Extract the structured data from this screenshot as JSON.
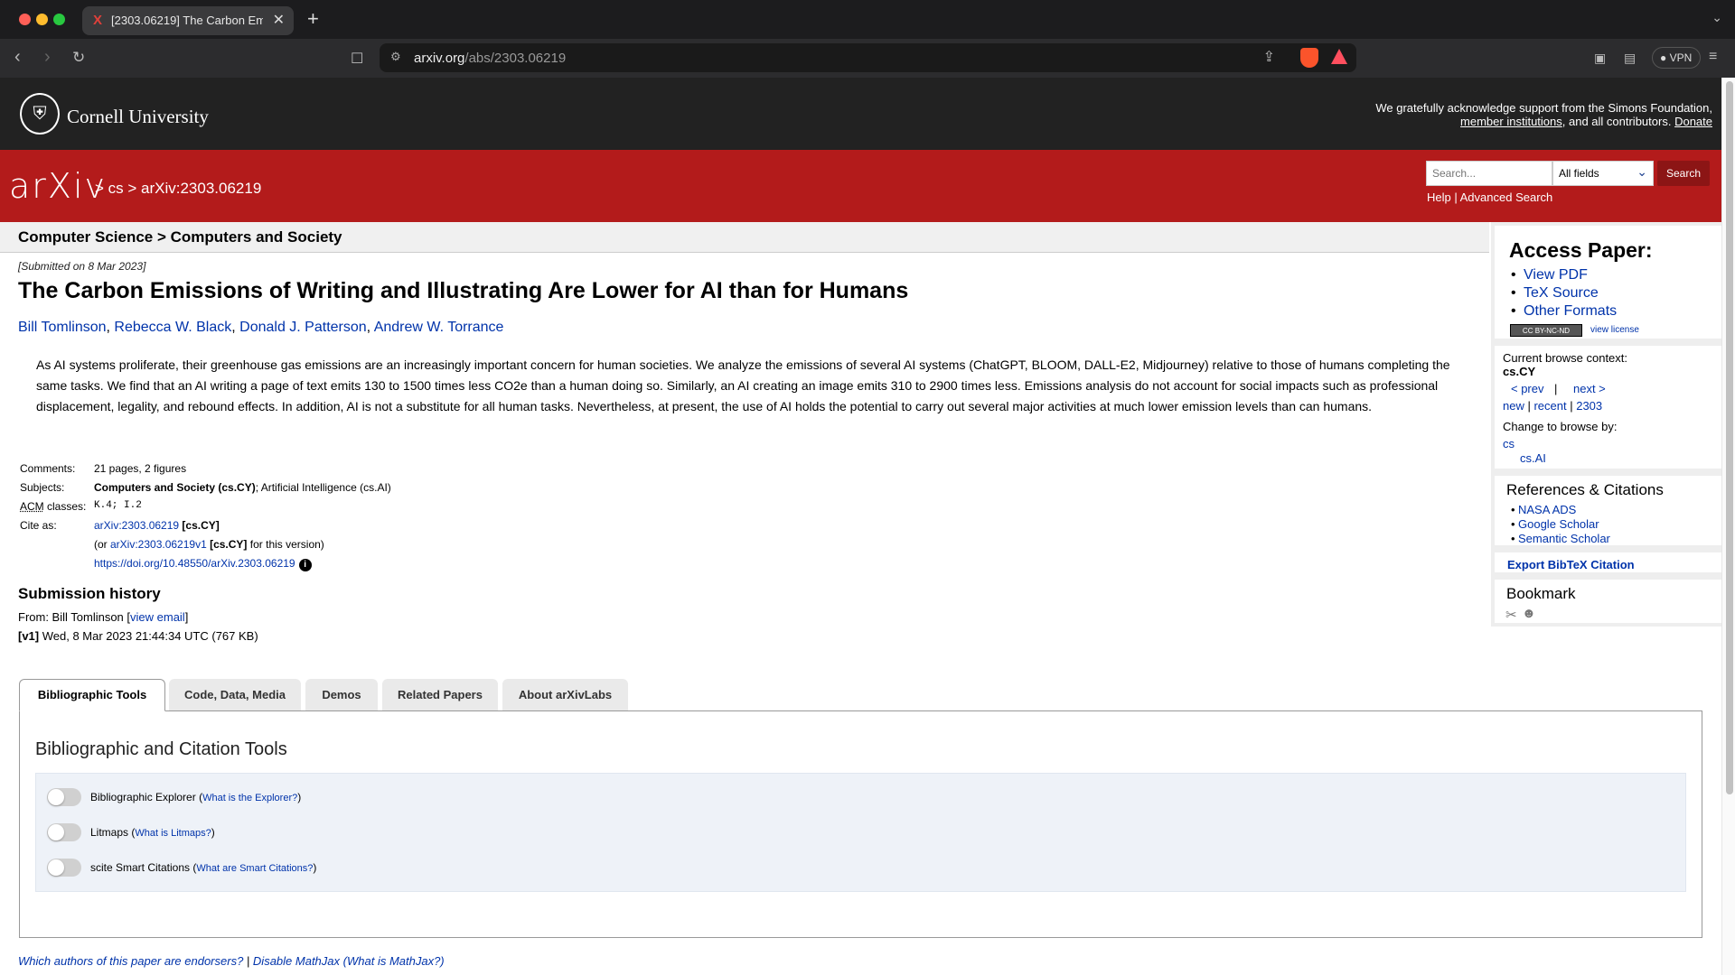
{
  "browser": {
    "tab_title": "[2303.06219] The Carbon Em",
    "tab_favicon": "X",
    "url_domain": "arxiv.org",
    "url_path": "/abs/2303.06219",
    "vpn_label": "VPN"
  },
  "cornell": {
    "name": "Cornell University",
    "ack_line1": "We gratefully acknowledge support from the Simons Foundation,",
    "ack_link1": "member institutions",
    "ack_mid": ", and all contributors.",
    "ack_link2": "Donate"
  },
  "arxiv_bar": {
    "logo": "arXiv",
    "breadcrumb": "> cs > arXiv:2303.06219",
    "search_placeholder": "Search...",
    "field_selected": "All fields",
    "search_button": "Search",
    "help": "Help",
    "sep": " | ",
    "advanced": "Advanced Search"
  },
  "subheader": "Computer Science > Computers and Society",
  "paper": {
    "dateline": "[Submitted on 8 Mar 2023]",
    "title": "The Carbon Emissions of Writing and Illustrating Are Lower for AI than for Humans",
    "authors": [
      "Bill Tomlinson",
      "Rebecca W. Black",
      "Donald J. Patterson",
      "Andrew W. Torrance"
    ],
    "abstract": "As AI systems proliferate, their greenhouse gas emissions are an increasingly important concern for human societies. We analyze the emissions of several AI systems (ChatGPT, BLOOM, DALL-E2, Midjourney) relative to those of humans completing the same tasks. We find that an AI writing a page of text emits 130 to 1500 times less CO2e than a human doing so. Similarly, an AI creating an image emits 310 to 2900 times less. Emissions analysis do not account for social impacts such as professional displacement, legality, and rebound effects. In addition, AI is not a substitute for all human tasks. Nevertheless, at present, the use of AI holds the potential to carry out several major activities at much lower emission levels than can humans.",
    "comments_label": "Comments:",
    "comments": "21 pages, 2 figures",
    "subjects_label": "Subjects:",
    "subjects_primary": "Computers and Society (cs.CY)",
    "subjects_rest": "; Artificial Intelligence (cs.AI)",
    "acm_abbr": "ACM",
    "acm_label_rest": " classes:",
    "acm_value": "K.4; I.2",
    "cite_label": "Cite as:",
    "cite_id": "arXiv:2303.06219",
    "cite_cat": " [cs.CY]",
    "cite_or": "(or ",
    "cite_v1": "arXiv:2303.06219v1",
    "cite_v1_cat": " [cs.CY]",
    "cite_v1_rest": " for this version)",
    "doi": "https://doi.org/10.48550/arXiv.2303.06219",
    "doi_info": "i"
  },
  "history": {
    "title": "Submission history",
    "from_text": "From: Bill Tomlinson [",
    "view_email": "view email",
    "from_close": "]",
    "v1_tag": "[v1]",
    "v1_text": " Wed, 8 Mar 2023 21:44:34 UTC (767 KB)"
  },
  "sidebar": {
    "access_title": "Access Paper:",
    "access_links": [
      "View PDF",
      "TeX Source",
      "Other Formats"
    ],
    "license_badge": "CC BY-NC-ND",
    "license_link": "view license",
    "context_label": "Current browse context:",
    "context_value": "cs.CY",
    "prev": "< prev",
    "pipe": "|",
    "next": "next >",
    "new": "new",
    "recent": "recent",
    "yymm": "2303",
    "change_label": "Change to browse by:",
    "browse_cs": "cs",
    "browse_csai": "cs.AI",
    "refs_title": "References & Citations",
    "refs_links": [
      "NASA ADS",
      "Google Scholar",
      "Semantic Scholar"
    ],
    "export_bibtex": "Export BibTeX Citation",
    "bookmark_title": "Bookmark"
  },
  "tabs": [
    "Bibliographic Tools",
    "Code, Data, Media",
    "Demos",
    "Related Papers",
    "About arXivLabs"
  ],
  "panel": {
    "title": "Bibliographic and Citation Tools",
    "toggles": [
      {
        "label": "Bibliographic Explorer",
        "help": "What is the Explorer?"
      },
      {
        "label": "Litmaps",
        "help": "What is Litmaps?"
      },
      {
        "label": "scite Smart Citations",
        "help": "What are Smart Citations?"
      }
    ]
  },
  "footer": {
    "endorsers": "Which authors of this paper are endorsers?",
    "sep": " | ",
    "mathjax": "Disable MathJax",
    "what_mathjax": "(What is MathJax?)"
  }
}
